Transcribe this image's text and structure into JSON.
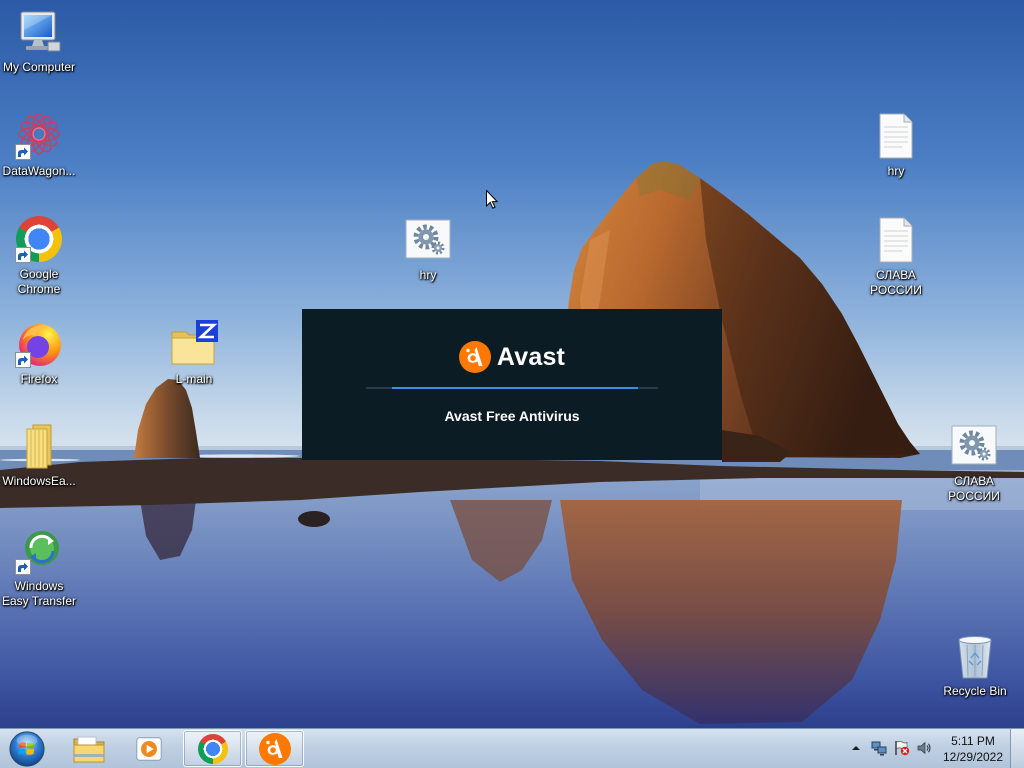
{
  "desktop": {
    "icons": [
      {
        "label": "My Computer",
        "icon": "computer-icon",
        "shortcut": false
      },
      {
        "label": "DataWagon...",
        "icon": "datawagon-icon",
        "shortcut": true
      },
      {
        "label": "Google\nChrome",
        "icon": "chrome-icon",
        "shortcut": true
      },
      {
        "label": "Firefox",
        "icon": "firefox-icon",
        "shortcut": true
      },
      {
        "label": "WindowsEa...",
        "icon": "archive-folder-icon",
        "shortcut": false
      },
      {
        "label": "Windows\nEasy Transfer",
        "icon": "easy-transfer-icon",
        "shortcut": true
      },
      {
        "label": "hry",
        "icon": "config-file-icon",
        "shortcut": false
      },
      {
        "label": "L-main",
        "icon": "zip-folder-icon",
        "shortcut": false
      },
      {
        "label": "hry",
        "icon": "text-file-icon",
        "shortcut": false
      },
      {
        "label": "СЛАВА\nРОССИИ",
        "icon": "text-file-icon",
        "shortcut": false
      },
      {
        "label": "СЛАВА\nРОССИИ",
        "icon": "config-file-icon",
        "shortcut": false
      },
      {
        "label": "Recycle Bin",
        "icon": "recycle-bin-icon",
        "shortcut": false
      }
    ]
  },
  "splash": {
    "brand": "Avast",
    "product": "Avast Free Antivirus",
    "logo_icon": "avast-logo-icon",
    "progress": 0.84,
    "colors": {
      "background": "#0c1c24",
      "brand_orange": "#ff7800",
      "progress_fill": "#3b8ee8",
      "progress_track": "#2a3a44"
    }
  },
  "taskbar": {
    "start_icon": "windows-start-orb-icon",
    "buttons": [
      {
        "icon": "windows-explorer-icon",
        "active": false
      },
      {
        "icon": "media-player-icon",
        "active": false
      },
      {
        "icon": "chrome-icon",
        "active": true
      },
      {
        "icon": "avast-icon",
        "active": true
      }
    ],
    "tray": {
      "icons": [
        "show-hidden-icons-icon",
        "network-icon",
        "action-center-flag-icon",
        "volume-icon"
      ],
      "time": "5:11 PM",
      "date": "12/29/2022"
    }
  },
  "cursor": "arrow-pointer-icon"
}
